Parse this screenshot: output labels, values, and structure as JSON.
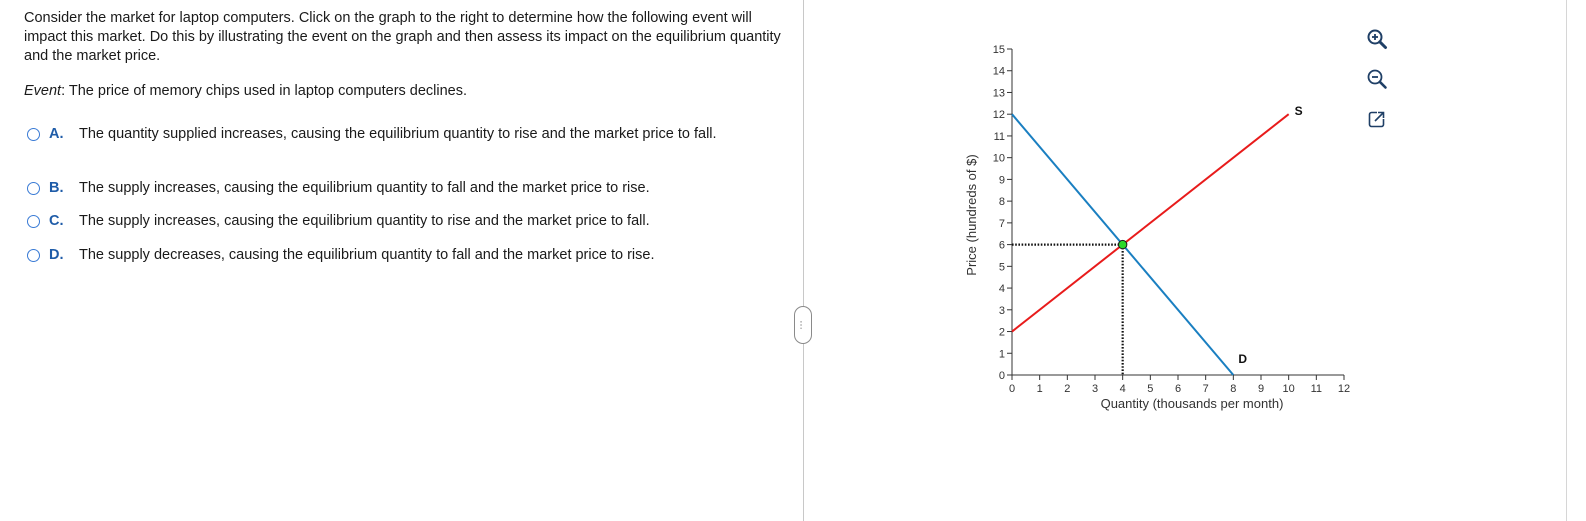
{
  "question": {
    "text": "Consider the market for laptop computers. Click on the graph to the right to determine how the following event will impact this market. Do this by illustrating the event on the graph and then assess its impact on the equilibrium quantity and the market price.",
    "event_label": "Event",
    "event_text": ": The price of memory chips used in laptop computers declines."
  },
  "options": [
    {
      "letter": "A.",
      "text": "The quantity supplied increases, causing the equilibrium quantity to rise and the market price to fall."
    },
    {
      "letter": "B.",
      "text": "The supply increases, causing the equilibrium quantity to fall and the market price to rise."
    },
    {
      "letter": "C.",
      "text": "The supply increases, causing the equilibrium quantity to rise and the market price to fall."
    },
    {
      "letter": "D.",
      "text": "The supply decreases, causing the equilibrium quantity to fall and the market price to rise."
    }
  ],
  "divider_handle_glyph": "…",
  "colors": {
    "demand": "#1a7fc1",
    "supply": "#e81b1b",
    "equilibrium": "#2bd92b",
    "accent": "#1f5ca8"
  },
  "tools": [
    "zoom-in-icon",
    "zoom-out-icon",
    "popout-icon"
  ],
  "chart_data": {
    "type": "line",
    "xlabel": "Quantity (thousands per month)",
    "ylabel": "Price (hundreds of $)",
    "xlim": [
      0,
      12
    ],
    "ylim": [
      0,
      15
    ],
    "x_ticks": [
      "0",
      "1",
      "2",
      "3",
      "4",
      "5",
      "6",
      "7",
      "8",
      "9",
      "10",
      "11",
      "12"
    ],
    "y_ticks": [
      "0",
      "1",
      "2",
      "3",
      "4",
      "5",
      "6",
      "7",
      "8",
      "9",
      "10",
      "11",
      "12",
      "13",
      "14",
      "15"
    ],
    "series": [
      {
        "name": "D",
        "color": "#1a7fc1",
        "x": [
          0,
          8
        ],
        "y": [
          12,
          0
        ]
      },
      {
        "name": "S",
        "color": "#e81b1b",
        "x": [
          0,
          10
        ],
        "y": [
          2,
          12
        ]
      }
    ],
    "equilibrium": {
      "x": 4,
      "y": 6
    },
    "grid": false
  }
}
